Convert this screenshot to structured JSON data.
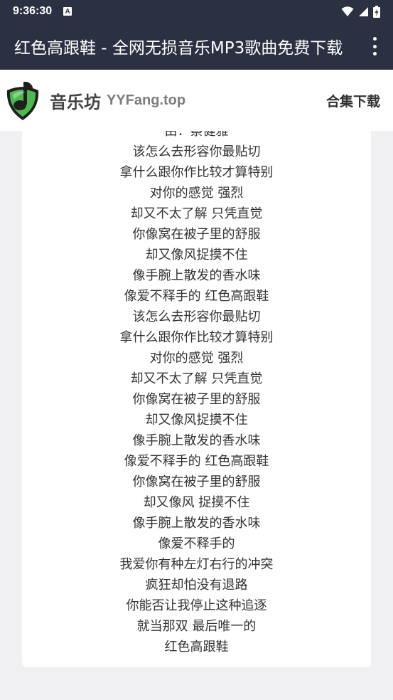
{
  "status_bar": {
    "time": "9:36:30",
    "notification_badge": "A"
  },
  "app_bar": {
    "title": "红色高跟鞋 - 全网无损音乐MP3歌曲免费下载"
  },
  "site_header": {
    "name": "音乐坊",
    "domain": "YYFang.top",
    "collection_link": "合集下载"
  },
  "lyrics": [
    "由：蔡健雅",
    "该怎么去形容你最贴切",
    "拿什么跟你作比较才算特别",
    "对你的感觉 强烈",
    "却又不太了解 只凭直觉",
    "你像窝在被子里的舒服",
    "却又像风捉摸不住",
    "像手腕上散发的香水味",
    "像爱不释手的 红色高跟鞋",
    "该怎么去形容你最贴切",
    "拿什么跟你作比较才算特别",
    "对你的感觉 强烈",
    "却又不太了解 只凭直觉",
    "你像窝在被子里的舒服",
    "却又像风捉摸不住",
    "像手腕上散发的香水味",
    "像爱不释手的 红色高跟鞋",
    "你像窝在被子里的舒服",
    "却又像风 捉摸不住",
    "像手腕上散发的香水味",
    "像爱不释手的",
    "我爱你有种左灯右行的冲突",
    "疯狂却怕没有退路",
    "你能否让我停止这种追逐",
    "就当那双 最后唯一的",
    "红色高跟鞋"
  ],
  "colors": {
    "app_bar_bg": "#2b3142",
    "page_bg": "#f0f0f3",
    "logo_green": "#4cbb4f"
  }
}
